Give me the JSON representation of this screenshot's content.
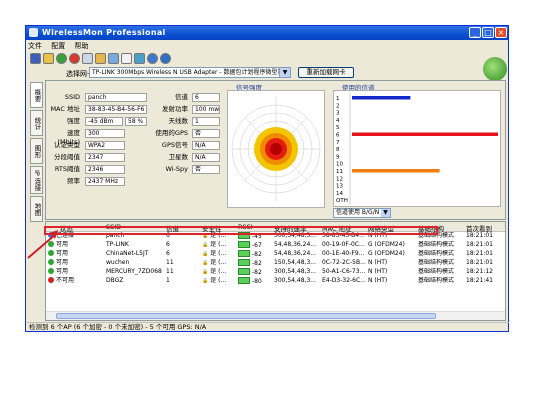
{
  "window": {
    "title": "WirelessMon Professional"
  },
  "menu": [
    "文件",
    "配置",
    "帮助"
  ],
  "toolbar": {
    "icons": [
      "save-icon",
      "open-icon",
      "start-icon",
      "stop-icon",
      "copy-icon",
      "folder-icon",
      "chart-icon",
      "report-icon",
      "options-icon",
      "info-icon",
      "help-icon"
    ]
  },
  "adapter": {
    "label": "选择网卡",
    "value": "TP-LINK 300Mbps Wireless N USB Adapter - 数据包计划程序微型端口",
    "reload_label": "重新加载网卡"
  },
  "side_tabs": [
    "概要",
    "统计",
    "图形",
    "IP 连接",
    "地图"
  ],
  "fields_left": [
    {
      "label": "SSID",
      "value": "panch"
    },
    {
      "label": "MAC 地址",
      "value": "38-83-45-B4-56-F6"
    },
    {
      "label": "强度",
      "value": "-45 dBm",
      "value2": "58 %"
    },
    {
      "label": "速度 (Mbits)",
      "value": "300"
    },
    {
      "label": "认证类型",
      "value": "WPA2"
    },
    {
      "label": "分段阈值",
      "value": "2347"
    },
    {
      "label": "RTS阈值",
      "value": "2346"
    },
    {
      "label": "频率",
      "value": "2437 MHz"
    }
  ],
  "fields_right": [
    {
      "label": "信道",
      "value": "6"
    },
    {
      "label": "发射功率",
      "value": "100 mw"
    },
    {
      "label": "天线数",
      "value": "1"
    },
    {
      "label": "使用的GPS",
      "value": "否"
    },
    {
      "label": "GPS信号",
      "value": "N/A"
    },
    {
      "label": "卫星数",
      "value": "N/A"
    },
    {
      "label": "Wi-Spy",
      "value": "否"
    }
  ],
  "signal_panel": {
    "title": "信号强度"
  },
  "channel_panel": {
    "title": "使用的信道",
    "channel_numbers": [
      "1",
      "2",
      "3",
      "4",
      "5",
      "6",
      "7",
      "8",
      "9",
      "10",
      "11",
      "12",
      "13",
      "14",
      "OTH"
    ],
    "bars": [
      {
        "channel": 1,
        "usage": 0.4,
        "color": "#1228c8"
      },
      {
        "channel": 6,
        "usage": 1.0,
        "color": "#e5121c"
      },
      {
        "channel": 11,
        "usage": 0.6,
        "color": "#f07e12"
      }
    ],
    "filter_value": "信道使用 B/G/N"
  },
  "table": {
    "columns": [
      "状态",
      "SSID",
      "信道",
      "安全性",
      "RSSI",
      "支持的速率",
      "MAC 地址",
      "网络类型",
      "基础结构",
      "首次看到"
    ],
    "rows": [
      {
        "status": "已连接",
        "status_color": "#2e6fd6",
        "ssid": "panch",
        "channel": "6",
        "security": "是 (...",
        "rssi": "-45",
        "rates": "300,54,48,3...",
        "mac": "38-83-45-B4...",
        "nettype": "N (HT)",
        "infra": "基础结构模式",
        "first_seen": "18:21:01"
      },
      {
        "status": "可用",
        "status_color": "#2fa62f",
        "ssid": "TP-LINK",
        "channel": "6",
        "security": "是 (...",
        "rssi": "-67",
        "rates": "54,48,36,24...",
        "mac": "00-19-0F-0C...",
        "nettype": "G (OFDM24)",
        "infra": "基础结构模式",
        "first_seen": "18:21:01"
      },
      {
        "status": "可用",
        "status_color": "#2fa62f",
        "ssid": "ChinaNet-L5JT",
        "channel": "6",
        "security": "是 (...",
        "rssi": "-82",
        "rates": "54,48,36,24...",
        "mac": "00-1E-40-F9...",
        "nettype": "G (OFDM24)",
        "infra": "基础结构模式",
        "first_seen": "18:21:01"
      },
      {
        "status": "可用",
        "status_color": "#2fa62f",
        "ssid": "wuchen",
        "channel": "11",
        "security": "是 (...",
        "rssi": "-82",
        "rates": "150,54,48,3...",
        "mac": "0C-72-2C-5B...",
        "nettype": "N (HT)",
        "infra": "基础结构模式",
        "first_seen": "18:21:01"
      },
      {
        "status": "可用",
        "status_color": "#2fa62f",
        "ssid": "MERCURY_7ZD068",
        "channel": "11",
        "security": "是 (...",
        "rssi": "-82",
        "rates": "300,54,48,3...",
        "mac": "50-A1-C6-73...",
        "nettype": "N (HT)",
        "infra": "基础结构模式",
        "first_seen": "18:21:12"
      },
      {
        "status": "不可用",
        "status_color": "#d62020",
        "ssid": "DBGZ",
        "channel": "1",
        "security": "是 (...",
        "rssi": "-80",
        "rates": "300,54,48,3...",
        "mac": "E4-D3-32-6C...",
        "nettype": "N (HT)",
        "infra": "基础结构模式",
        "first_seen": "18:21:41"
      }
    ]
  },
  "status_bar": "检测到 6 个AP (6 个加密 - 0 个未加密) - 5 个可用    GPS: N/A"
}
